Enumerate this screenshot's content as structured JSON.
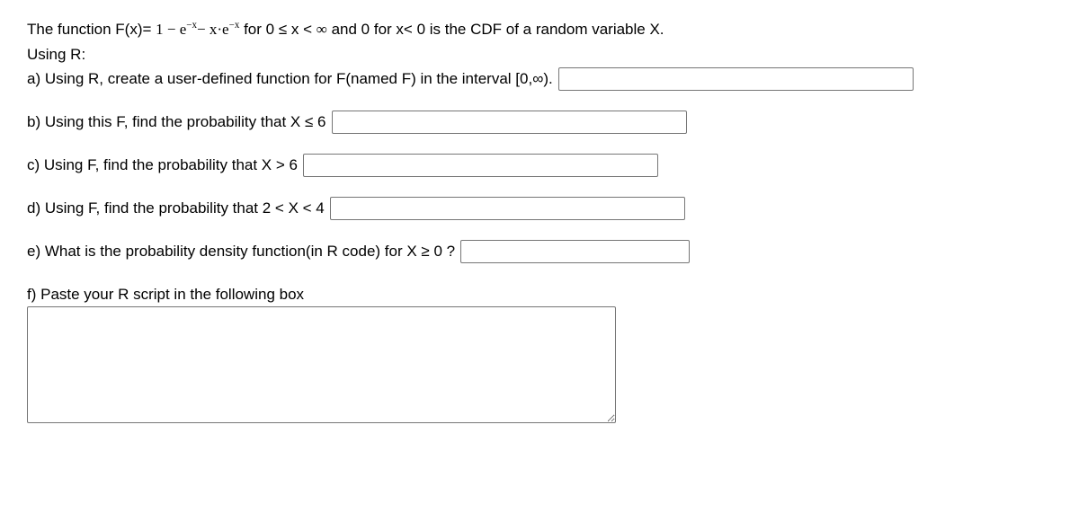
{
  "intro": {
    "line1_prefix": "The function F(x)= ",
    "formula": "1 − e",
    "sup1": "−x",
    "mid1": "− x·e",
    "sup2": "−x",
    "cond1": " for 0  ≤ x < ",
    "infty": "∞",
    "cond2": "  and 0 for x< 0 is the CDF of a random variable X.",
    "line2": "Using R:"
  },
  "parts": {
    "a": "a) Using R, create a user-defined function for F(named F) in the interval [0,∞).",
    "b": "b) Using this F, find the probability that X ≤ 6",
    "c": "c) Using F, find the probability that X > 6",
    "d": "d) Using F, find the probability that 2 < X < 4",
    "e": "e) What is the probability density function(in R code) for X ≥ 0 ?",
    "f": "f) Paste your R script in the following box"
  },
  "inputs": {
    "a": "",
    "b": "",
    "c": "",
    "d": "",
    "e": "",
    "f": ""
  }
}
